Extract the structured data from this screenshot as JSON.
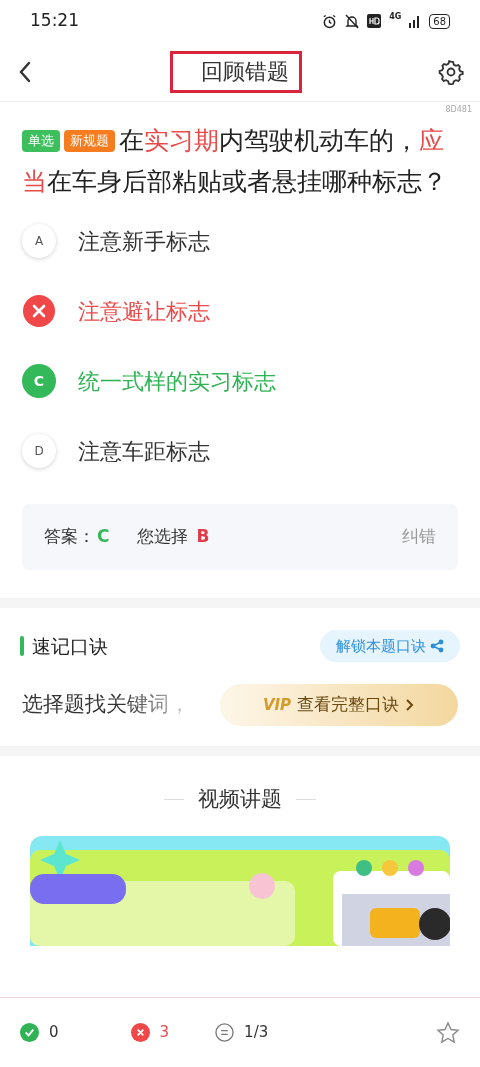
{
  "status_bar": {
    "time": "15:21",
    "battery": "68",
    "network": "4G"
  },
  "header": {
    "title": "回顾错题",
    "highlighted": true
  },
  "question_id": "8D481",
  "question": {
    "tags": [
      {
        "label": "单选",
        "color": "#3cbf5c"
      },
      {
        "label": "新规题",
        "color": "#f57c1f"
      }
    ],
    "segments": [
      {
        "text": "在",
        "highlight": false
      },
      {
        "text": "实习期",
        "highlight": true
      },
      {
        "text": "内驾驶机动车的，",
        "highlight": false
      },
      {
        "text": "应当",
        "highlight": true
      },
      {
        "text": "在车身后部粘贴或者悬挂哪种标志？",
        "highlight": false
      }
    ]
  },
  "options": [
    {
      "letter": "A",
      "text": "注意新手标志",
      "kind": "normal"
    },
    {
      "text": "注意避让标志",
      "kind": "wrong"
    },
    {
      "letter": "C",
      "text": "统一式样的实习标志",
      "kind": "correct"
    },
    {
      "letter": "D",
      "text": "注意车距标志",
      "kind": "normal"
    }
  ],
  "answer": {
    "label": "答案：",
    "correct": "C",
    "chosen_label": "您选择",
    "chosen": "B",
    "report": "纠错"
  },
  "mnemonic": {
    "title": "速记口诀",
    "unlock_button": "解锁本题口诀",
    "preview": "选择题找关键词，",
    "vip_badge": "VIP",
    "vip_button": "查看完整口诀"
  },
  "video": {
    "title": "视频讲题"
  },
  "bottom_bar": {
    "correct_count": "0",
    "wrong_count": "3",
    "progress": "1/3"
  }
}
